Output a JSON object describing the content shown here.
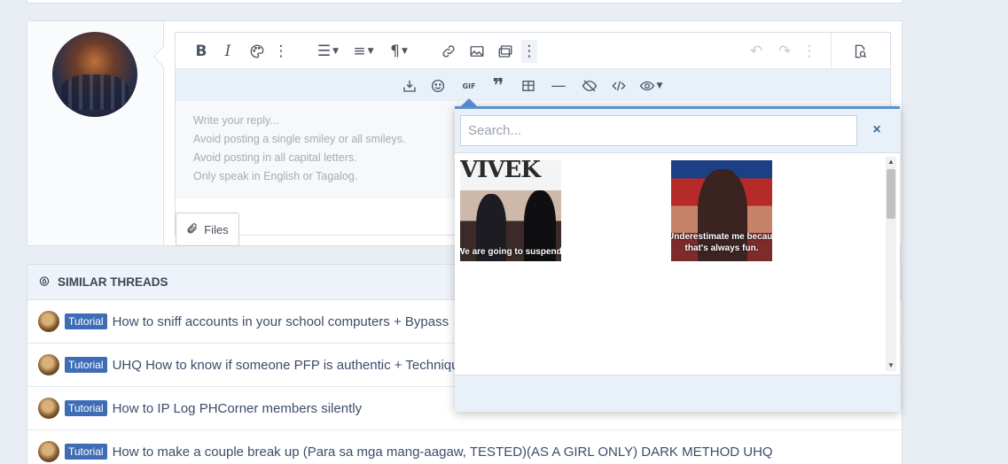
{
  "editor": {
    "placeholder_lines": [
      "Write your reply...",
      "Avoid posting a single smiley or all smileys.",
      "Avoid posting in all capital letters.",
      "Only speak in English or Tagalog."
    ],
    "files_label": "Files",
    "toolbar_icons": [
      "bold-icon",
      "italic-icon",
      "palette-icon",
      "more-vertical-icon",
      "list-icon",
      "align-icon",
      "paragraph-icon",
      "link-icon",
      "image-icon",
      "media-icon",
      "more-vertical-icon",
      "undo-icon",
      "redo-icon",
      "more-vertical-icon",
      "preview-icon"
    ],
    "second_row_icons": [
      "drafts-icon",
      "emoji-icon",
      "gif-icon",
      "quote-icon",
      "table-icon",
      "hr-icon",
      "spoiler-icon",
      "code-icon",
      "view-icon"
    ],
    "gif_label": "GIF"
  },
  "gif_picker": {
    "search_placeholder": "Search...",
    "close_symbol": "×",
    "results": [
      {
        "top_text": "VIVEK",
        "caption": "We are going to suspend our presidential campaign"
      },
      {
        "top_text": "",
        "caption_line1": "Underestimate me because",
        "caption_line2": "that's always fun."
      }
    ]
  },
  "similar": {
    "header": "SIMILAR THREADS",
    "threads": [
      {
        "tag": "Tutorial",
        "title": "How to sniff accounts in your school computers + Bypass"
      },
      {
        "tag": "Tutorial",
        "title": "UHQ How to know if someone PFP is authentic + Technique"
      },
      {
        "tag": "Tutorial",
        "title": "How to IP Log PHCorner members silently"
      },
      {
        "tag": "Tutorial",
        "title": "How to make a couple break up (Para sa mga mang-aagaw, TESTED)(AS A GIRL ONLY) DARK METHOD UHQ"
      }
    ]
  },
  "colors": {
    "accent": "#5b8fd0",
    "tag_bg": "#3e6db5",
    "toolbar_bg": "#e8f1fa"
  }
}
